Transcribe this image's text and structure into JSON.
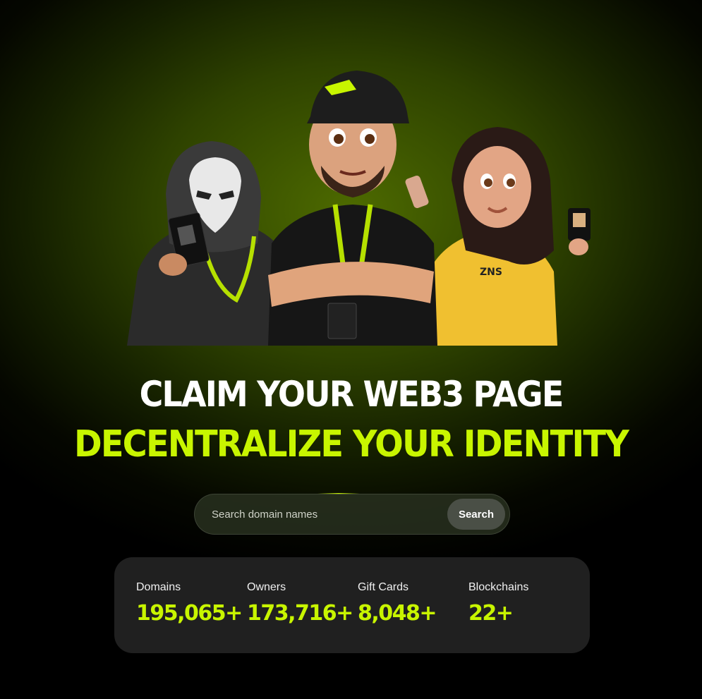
{
  "hero": {
    "title_line1": "CLAIM YOUR WEB3 PAGE",
    "title_line2": "DECENTRALIZE YOUR IDENTITY",
    "cap_logo": "ZNS"
  },
  "search": {
    "placeholder": "Search domain names",
    "button_label": "Search"
  },
  "stats": [
    {
      "label": "Domains",
      "value": "195,065+"
    },
    {
      "label": "Owners",
      "value": "173,716+"
    },
    {
      "label": "Gift Cards",
      "value": "8,048+"
    },
    {
      "label": "Blockchains",
      "value": "22+"
    }
  ],
  "colors": {
    "accent": "#c8f500",
    "card_bg": "#202020",
    "background_glow": "#4d6a00"
  }
}
